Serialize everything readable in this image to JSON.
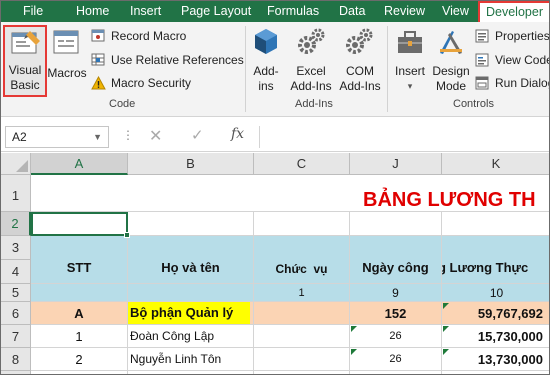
{
  "menu": {
    "file": "File",
    "home": "Home",
    "insert": "Insert",
    "page_layout": "Page Layout",
    "formulas": "Formulas",
    "data": "Data",
    "review": "Review",
    "view": "View",
    "developer": "Developer"
  },
  "ribbon": {
    "visual_basic_1": "Visual",
    "visual_basic_2": "Basic",
    "macros": "Macros",
    "record_macro": "Record Macro",
    "use_relative_references": "Use Relative References",
    "macro_security": "Macro Security",
    "code_group": "Code",
    "addins_1": "Add-",
    "addins_2": "ins",
    "excel_addins_1": "Excel",
    "excel_addins_2": "Add-Ins",
    "com_addins_1": "COM",
    "com_addins_2": "Add-Ins",
    "addins_group": "Add-Ins",
    "insert": "Insert",
    "design_mode_1": "Design",
    "design_mode_2": "Mode",
    "properties": "Properties",
    "view_code": "View Code",
    "run_dialog": "Run Dialog",
    "controls_group": "Controls"
  },
  "formula_bar": {
    "name_box": "A2",
    "fx": "fx",
    "formula": ""
  },
  "columns": [
    "A",
    "B",
    "C",
    "J",
    "K"
  ],
  "rows": [
    "1",
    "2",
    "3",
    "4",
    "5",
    "6",
    "7",
    "8"
  ],
  "sheet": {
    "title": "BẢNG LƯƠNG TH",
    "hdr_stt": "STT",
    "hdr_name": "Họ và tên",
    "hdr_position": "Chức  vụ",
    "hdr_days": "Ngày công",
    "hdr_salary": "g Lương Thực",
    "num_c": "1",
    "num_j": "9",
    "num_k": "10",
    "r6_a": "A",
    "r6_b": "Bộ phận Quản lý",
    "r6_j": "152",
    "r6_k": "59,767,692",
    "r7_a": "1",
    "r7_b": "Đoàn Công Lập",
    "r7_j": "26",
    "r7_k": "15,730,000",
    "r8_a": "2",
    "r8_b": "Nguyễn Linh Tôn",
    "r8_j": "26",
    "r8_k": "13,730,000"
  },
  "colors": {
    "accent": "#217346",
    "highlight_border": "#e53935",
    "title_red": "#e00000",
    "header_blue": "#b7dde8",
    "section_peach": "#fbd4b4",
    "yellow": "#ffff00"
  }
}
